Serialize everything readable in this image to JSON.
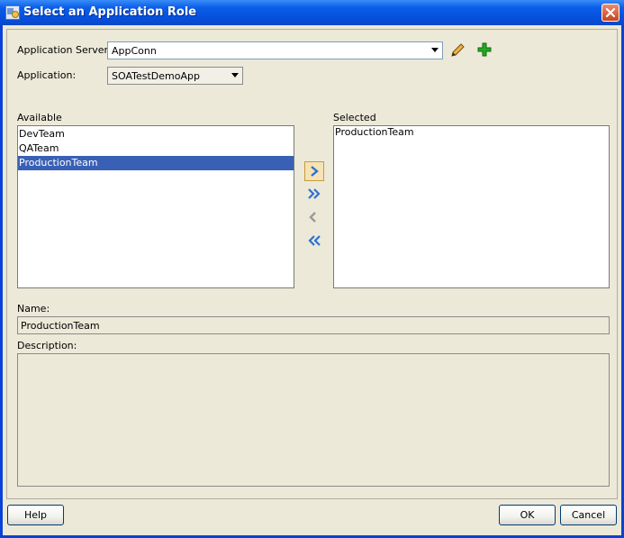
{
  "window": {
    "title": "Select an Application Role",
    "close_label": "×"
  },
  "form": {
    "app_server_label": "Application Server:",
    "app_server_value": "AppConn",
    "application_label": "Application:",
    "application_value": "SOATestDemoApp"
  },
  "available": {
    "label": "Available",
    "items": [
      "DevTeam",
      "QATeam",
      "ProductionTeam"
    ],
    "selected_index": 2
  },
  "selected": {
    "label": "Selected",
    "items": [
      "ProductionTeam"
    ]
  },
  "details": {
    "name_label": "Name:",
    "name_value": "ProductionTeam",
    "description_label": "Description:",
    "description_value": ""
  },
  "buttons": {
    "help": "Help",
    "ok": "OK",
    "cancel": "Cancel"
  },
  "icons": {
    "title": "app-role-icon",
    "edit": "pencil-icon",
    "add": "plus-icon",
    "move_right": "chevron-right-icon",
    "move_all_right": "double-chevron-right-icon",
    "move_left": "chevron-left-icon",
    "move_all_left": "double-chevron-left-icon"
  },
  "colors": {
    "title_bar": "#0b5ee8",
    "selection": "#3960b5",
    "add_icon": "#23a823",
    "shuttle_icon": "#2f6fd0"
  }
}
